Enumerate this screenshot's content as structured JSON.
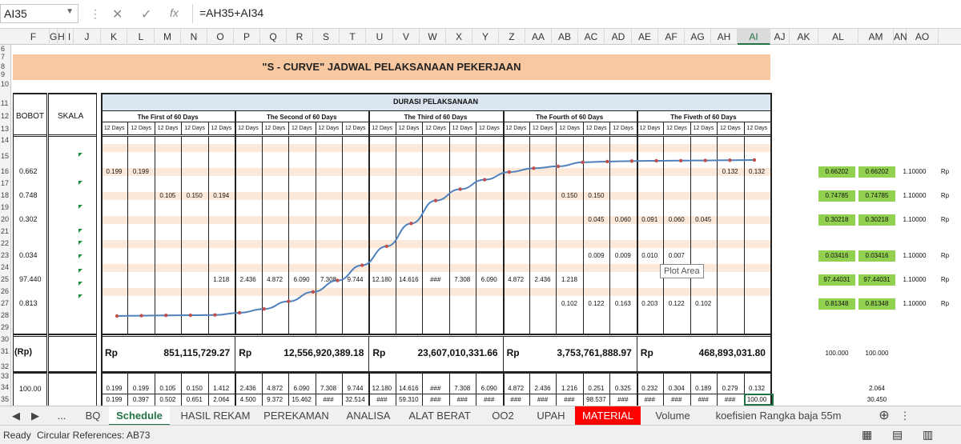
{
  "formula_bar": {
    "name_box": "AI35",
    "formula": "=AH35+AI34",
    "fx": "fx"
  },
  "columns": [
    "F",
    "G",
    "H",
    "I",
    "J",
    "K",
    "L",
    "M",
    "N",
    "O",
    "P",
    "Q",
    "R",
    "S",
    "T",
    "U",
    "V",
    "W",
    "X",
    "Y",
    "Z",
    "AA",
    "AB",
    "AC",
    "AD",
    "AE",
    "AF",
    "AG",
    "AH",
    "AI",
    "AJ",
    "AK",
    "AL",
    "AM",
    "AN",
    "AO"
  ],
  "active_column": "AI",
  "rows": [
    "6",
    "7",
    "8",
    "9",
    "10",
    "11",
    "12",
    "13",
    "14",
    "15",
    "16",
    "17",
    "18",
    "19",
    "20",
    "21",
    "22",
    "23",
    "24",
    "25",
    "26",
    "27",
    "28",
    "29",
    "30",
    "31",
    "32",
    "33",
    "34",
    "35"
  ],
  "sheet": {
    "title": "\"S - CURVE\" JADWAL PELAKSANAAN PEKERJAAN",
    "col_bobot": "BOBOT",
    "col_skala": "SKALA",
    "durasi": "DURASI PELAKSANAAN",
    "periods": [
      "The First of 60 Days",
      "The Second of 60 Days",
      "The Third of 60 Days",
      "The Fourth of 60 Days",
      "The Fiveth of 60 Days"
    ],
    "sub_label": "12 Days",
    "bobot_values": [
      "0.662",
      "0.748",
      "0.302",
      "0.034",
      "97.440",
      "0.813"
    ],
    "rp_label": "(Rp)",
    "rp_symbol": "Rp",
    "rp_totals": [
      "851,115,729.27",
      "12,556,920,389.18",
      "23,607,010,331.66",
      "3,753,761,888.97",
      "468,893,031.80"
    ],
    "row34_label": "100.00",
    "task_rows": [
      [
        "0.199",
        "0.199",
        "",
        "",
        "",
        "",
        "",
        "",
        "",
        "",
        "",
        "",
        "",
        "",
        "",
        "",
        "",
        "",
        "",
        "",
        "",
        "",
        "",
        "0.132",
        "0.132"
      ],
      [
        "",
        "",
        "0.105",
        "0.150",
        "0.194",
        "",
        "",
        "",
        "",
        "",
        "",
        "",
        "",
        "",
        "",
        "",
        "",
        "0.150",
        "0.150",
        "",
        "",
        "",
        "",
        "",
        ""
      ],
      [
        "",
        "",
        "",
        "",
        "",
        "",
        "",
        "",
        "",
        "",
        "",
        "",
        "",
        "",
        "",
        "",
        "",
        "",
        "0.045",
        "0.060",
        "0.091",
        "0.060",
        "0.045",
        "",
        ""
      ],
      [
        "",
        "",
        "",
        "",
        "",
        "",
        "",
        "",
        "",
        "",
        "",
        "",
        "",
        "",
        "",
        "",
        "",
        "",
        "0.009",
        "0.009",
        "0.010",
        "0.007",
        "",
        "",
        ""
      ],
      [
        "",
        "",
        "",
        "",
        "1.218",
        "2.436",
        "4.872",
        "6.090",
        "7.308",
        "9.744",
        "12.180",
        "14.616",
        "###",
        "7.308",
        "6.090",
        "4.872",
        "2.436",
        "1.218",
        "",
        "",
        "",
        "",
        "",
        "",
        ""
      ],
      [
        "",
        "",
        "",
        "",
        "",
        "",
        "",
        "",
        "",
        "",
        "",
        "",
        "",
        "",
        "",
        "",
        "",
        "0.102",
        "0.122",
        "0.163",
        "0.203",
        "0.122",
        "0.102",
        "",
        ""
      ]
    ],
    "row34_values": [
      "0.199",
      "0.199",
      "0.105",
      "0.150",
      "1.412",
      "2.436",
      "4.872",
      "6.090",
      "7.308",
      "9.744",
      "12.180",
      "14.616",
      "###",
      "7.308",
      "6.090",
      "4.872",
      "2.436",
      "1.216",
      "0.251",
      "0.325",
      "0.232",
      "0.304",
      "0.189",
      "0.279",
      "0.132"
    ],
    "row35_values": [
      "0.199",
      "0.397",
      "0.502",
      "0.651",
      "2.064",
      "4.500",
      "9.372",
      "15.462",
      "###",
      "32.514",
      "###",
      "59.310",
      "###",
      "###",
      "###",
      "###",
      "###",
      "###",
      "98.537",
      "###",
      "###",
      "###",
      "###",
      "###",
      "100.00"
    ],
    "green_cells": [
      [
        "0.66202",
        "0.66202"
      ],
      [
        "0.74785",
        "0.74785"
      ],
      [
        "0.30218",
        "0.30218"
      ],
      [
        "0.03416",
        "0.03416"
      ],
      [
        "97.44031",
        "97.44031"
      ],
      [
        "0.81348",
        "0.81348"
      ]
    ],
    "an_values": [
      "1.10000",
      "1.10000",
      "1.10000",
      "1.10000",
      "1.10000",
      "1.10000"
    ],
    "rp_short": "Rp",
    "right_totals": [
      "100.000",
      "100.000"
    ],
    "am34": "2.064",
    "am35": "30.450",
    "curve_pct": [
      0,
      0.199,
      0.397,
      0.502,
      0.651,
      2.064,
      4.5,
      9.372,
      15.462,
      22.77,
      32.514,
      44.694,
      59.31,
      74.0,
      81.3,
      87.4,
      92.27,
      94.71,
      95.93,
      98.537,
      99.0,
      99.3,
      99.5,
      99.6,
      99.7,
      99.868,
      100
    ]
  },
  "tooltip": "Plot Area",
  "tabs": [
    "...",
    "BQ",
    "Schedule",
    "HASIL REKAM",
    "PEREKAMAN",
    "ANALISA",
    "ALAT BERAT",
    "OO2",
    "UPAH",
    "MATERIAL",
    "Volume",
    "koefisien Rangka baja 55m"
  ],
  "active_tab": "Schedule",
  "status": {
    "mode": "Ready",
    "message": "Circular References: AB73"
  }
}
